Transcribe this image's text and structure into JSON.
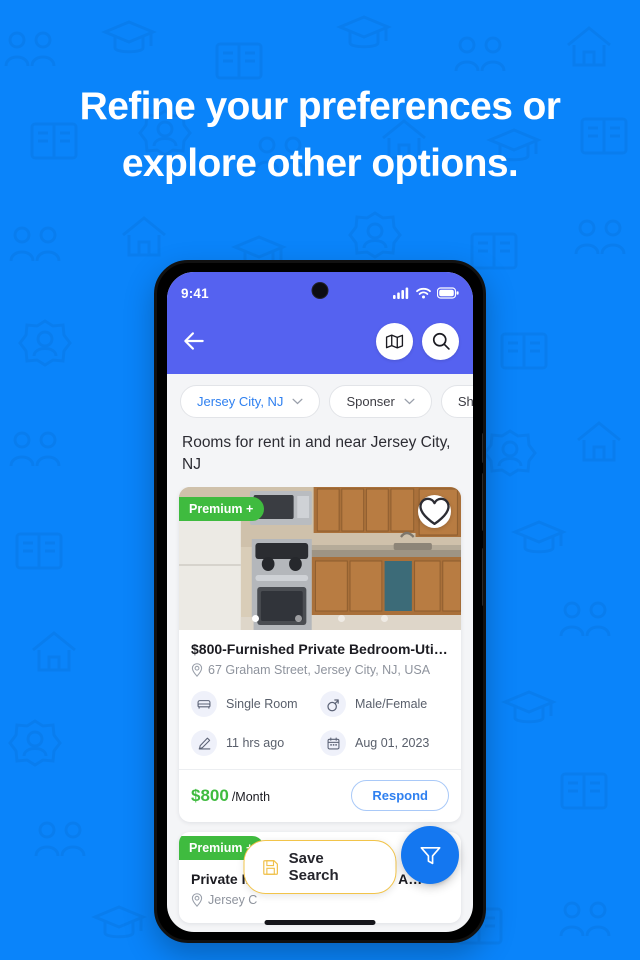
{
  "promo": {
    "headline_line1": "Refine your preferences or",
    "headline_line2": "explore other options.",
    "background_color": "#0a84fa"
  },
  "phone": {
    "status_bar": {
      "time": "9:41",
      "icons": [
        "signal-icon",
        "wifi-icon",
        "battery-icon"
      ]
    },
    "header": {
      "background_color": "#5562f0",
      "back_icon": "back-arrow-icon",
      "map_icon": "map-icon",
      "search_icon": "search-icon"
    },
    "filters": {
      "chips": [
        {
          "label": "Jersey City, NJ",
          "active": true
        },
        {
          "label": "Sponser",
          "active": false
        },
        {
          "label": "Sha",
          "active": false
        }
      ]
    },
    "list_heading": "Rooms for rent in and near Jersey City, NJ",
    "cards": [
      {
        "badge": "Premium +",
        "badge_color": "#3fbb3f",
        "favorite_icon": "heart-icon",
        "carousel_dots": 4,
        "carousel_active": 1,
        "title": "$800-Furnished Private Bedroom-Utili…",
        "address": "67 Graham Street, Jersey City, NJ, USA",
        "specs": [
          {
            "icon": "bed-icon",
            "text": "Single Room"
          },
          {
            "icon": "gender-icon",
            "text": "Male/Female"
          },
          {
            "icon": "pencil-icon",
            "text": "11 hrs ago"
          },
          {
            "icon": "calendar-icon",
            "text": "Aug 01, 2023"
          }
        ],
        "price": "$800",
        "price_unit": "/Month",
        "price_color": "#3fbb3f",
        "action_label": "Respond"
      },
      {
        "badge": "Premium +",
        "badge_color": "#3fbb3f",
        "favorite_icon": "heart-icon",
        "title": "Private Independant Room For A…",
        "address": "Jersey C"
      }
    ],
    "save_search": {
      "label": "Save Search",
      "icon": "save-disk-icon",
      "border_color": "#f2c44a"
    },
    "filter_fab": {
      "icon": "funnel-filter-icon",
      "color": "#1477f0"
    }
  }
}
